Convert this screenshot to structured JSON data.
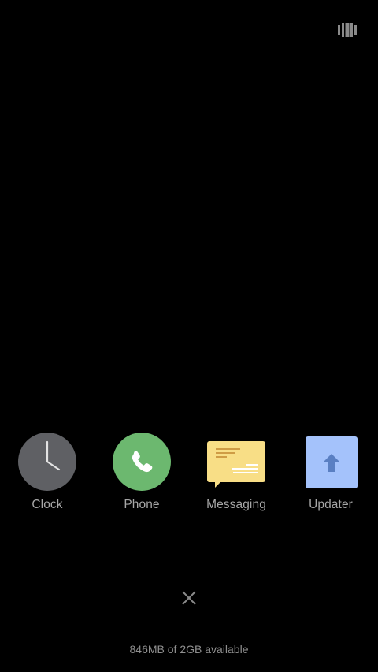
{
  "header": {
    "view_toggle_icon": "view-switch-icon"
  },
  "recent_apps": [
    {
      "label": "Clock",
      "icon": "clock-icon",
      "color": "#5f6064"
    },
    {
      "label": "Phone",
      "icon": "phone-icon",
      "color": "#6cb86f"
    },
    {
      "label": "Messaging",
      "icon": "message-icon",
      "color": "#f8de86"
    },
    {
      "label": "Updater",
      "icon": "upload-icon",
      "color": "#a4c2fb"
    }
  ],
  "footer": {
    "close_all_icon": "close-icon",
    "memory_text": "846MB of 2GB available"
  },
  "colors": {
    "background": "#000000",
    "label": "#a6a6a6",
    "icon_gray": "#8a8a8a"
  }
}
